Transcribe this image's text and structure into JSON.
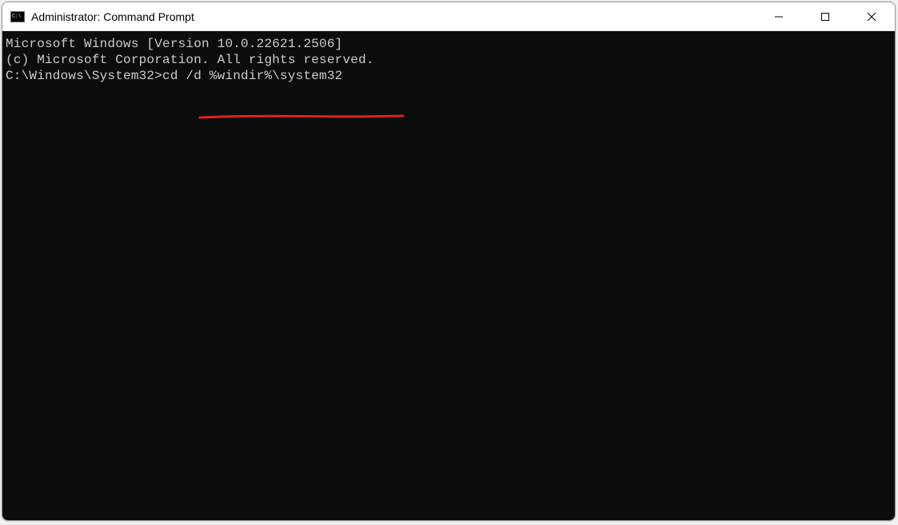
{
  "window": {
    "title": "Administrator: Command Prompt",
    "icon_label": "C:\\"
  },
  "terminal": {
    "line1": "Microsoft Windows [Version 10.0.22621.2506]",
    "line2": "(c) Microsoft Corporation. All rights reserved.",
    "blank": "",
    "prompt": "C:\\Windows\\System32>",
    "command": "cd /d %windir%\\system32"
  },
  "annotation": {
    "color": "#e02020"
  }
}
